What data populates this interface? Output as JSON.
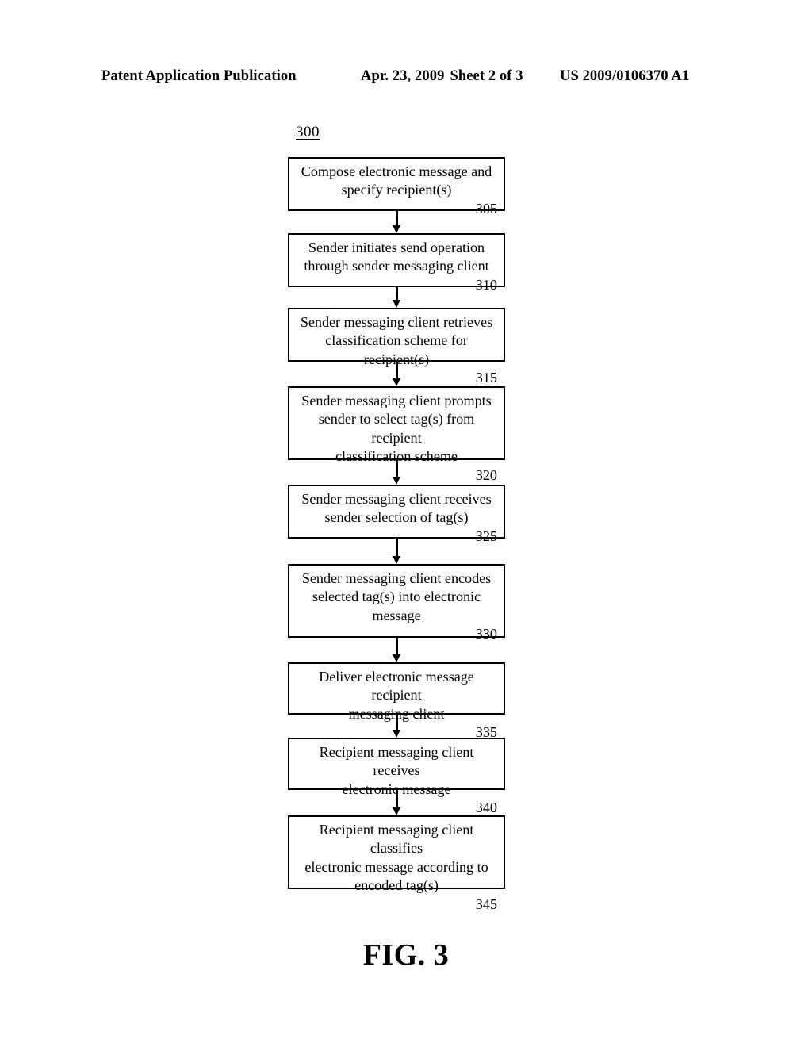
{
  "header": {
    "publication_label": "Patent Application Publication",
    "date": "Apr. 23, 2009",
    "sheet": "Sheet 2 of 3",
    "publication_number": "US 2009/0106370 A1"
  },
  "figure": {
    "reference_numeral": "300",
    "caption": "FIG. 3"
  },
  "flowchart": {
    "type": "flowchart",
    "orientation": "vertical",
    "steps": [
      {
        "id": "305",
        "text": "Compose electronic message and specify recipient(s)",
        "lines": [
          "Compose electronic message and",
          "specify recipient(s)"
        ],
        "number": "305"
      },
      {
        "id": "310",
        "text": "Sender initiates send operation through sender messaging client",
        "lines": [
          "Sender initiates send operation",
          "through sender messaging client"
        ],
        "number": "310"
      },
      {
        "id": "315",
        "text": "Sender messaging client retrieves classification scheme for recipient(s)",
        "lines": [
          "Sender messaging client retrieves",
          "classification scheme for recipient(s)"
        ],
        "number": "315"
      },
      {
        "id": "320",
        "text": "Sender messaging client prompts sender to select tag(s) from recipient classification scheme",
        "lines": [
          "Sender messaging client prompts",
          "sender to select tag(s) from recipient",
          "classification scheme"
        ],
        "number": "320"
      },
      {
        "id": "325",
        "text": "Sender messaging client receives sender selection of tag(s)",
        "lines": [
          "Sender messaging client receives",
          "sender selection of tag(s)"
        ],
        "number": "325"
      },
      {
        "id": "330",
        "text": "Sender messaging client encodes selected tag(s) into electronic message",
        "lines": [
          "Sender messaging client encodes",
          "selected tag(s) into electronic",
          "message"
        ],
        "number": "330"
      },
      {
        "id": "335",
        "text": "Deliver electronic message recipient messaging client",
        "lines": [
          "Deliver electronic message recipient",
          "messaging client"
        ],
        "number": "335"
      },
      {
        "id": "340",
        "text": "Recipient messaging client receives electronic message",
        "lines": [
          "Recipient messaging client receives",
          "electronic message"
        ],
        "number": "340"
      },
      {
        "id": "345",
        "text": "Recipient messaging client classifies electronic message according to encoded tag(s)",
        "lines": [
          "Recipient messaging client classifies",
          "electronic message according to",
          "encoded tag(s)"
        ],
        "number": "345"
      }
    ],
    "connectors": [
      {
        "from": "305",
        "to": "310",
        "arrow": "down-arrow"
      },
      {
        "from": "310",
        "to": "315",
        "arrow": "down-arrow"
      },
      {
        "from": "315",
        "to": "320",
        "arrow": "down-arrow"
      },
      {
        "from": "320",
        "to": "325",
        "arrow": "down-arrow"
      },
      {
        "from": "325",
        "to": "330",
        "arrow": "down-arrow"
      },
      {
        "from": "330",
        "to": "335",
        "arrow": "down-arrow"
      },
      {
        "from": "335",
        "to": "340",
        "arrow": "down-arrow"
      },
      {
        "from": "340",
        "to": "345",
        "arrow": "down-arrow"
      }
    ]
  },
  "colors": {
    "page_background": "#ffffff",
    "ink": "#000000",
    "box_border": "#000000"
  }
}
